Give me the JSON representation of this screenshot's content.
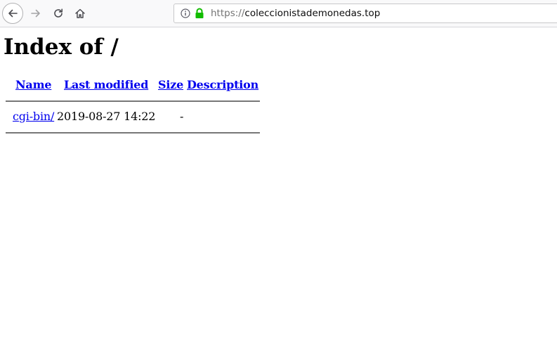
{
  "browser": {
    "url_scheme": "https://",
    "url_host": "coleccionistademonedas.top"
  },
  "page": {
    "title": "Index of /",
    "columns": {
      "name": "Name",
      "last_modified": "Last modified",
      "size": "Size",
      "description": "Description"
    },
    "rows": [
      {
        "name": "cgi-bin/",
        "last_modified": "2019-08-27 14:22",
        "size": "-",
        "description": ""
      }
    ]
  }
}
